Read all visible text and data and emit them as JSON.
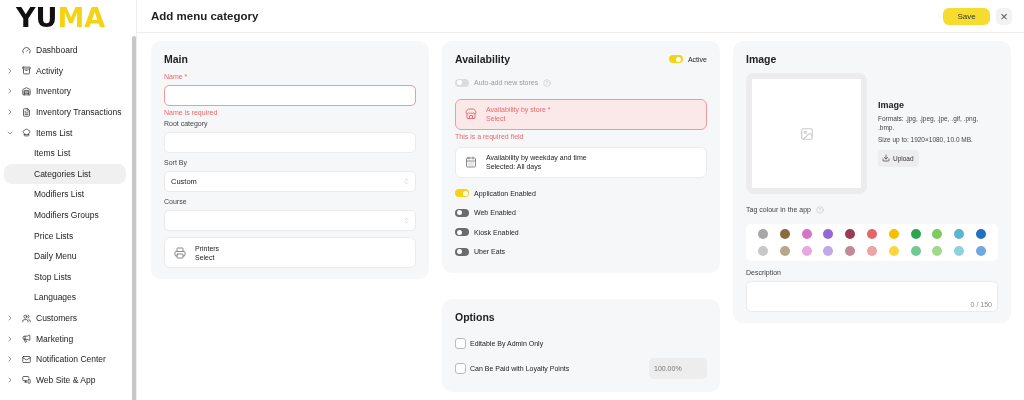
{
  "logo": {
    "dark": "YU",
    "accent": "MA"
  },
  "sidebar": {
    "items": [
      {
        "label": "Dashboard",
        "selected": false
      },
      {
        "label": "Activity",
        "selected": false,
        "expanded": false
      },
      {
        "label": "Inventory",
        "selected": false,
        "expanded": false
      },
      {
        "label": "Inventory Transactions",
        "selected": false,
        "expanded": false
      },
      {
        "label": "Items List",
        "selected": false,
        "expanded": true,
        "children": [
          {
            "label": "Items List",
            "selected": false
          },
          {
            "label": "Categories List",
            "selected": true
          },
          {
            "label": "Modifiers List",
            "selected": false
          },
          {
            "label": "Modifiers Groups",
            "selected": false
          },
          {
            "label": "Price Lists",
            "selected": false
          },
          {
            "label": "Daily Menu",
            "selected": false
          },
          {
            "label": "Stop Lists",
            "selected": false
          },
          {
            "label": "Languages",
            "selected": false
          }
        ]
      },
      {
        "label": "Customers",
        "selected": false,
        "expanded": false
      },
      {
        "label": "Marketing",
        "selected": false,
        "expanded": false
      },
      {
        "label": "Notification Center",
        "selected": false,
        "expanded": false
      },
      {
        "label": "Web Site & App",
        "selected": false,
        "expanded": false
      }
    ]
  },
  "header": {
    "title": "Add menu category",
    "save": "Save",
    "close": "×"
  },
  "main": {
    "title": "Main",
    "fields": [
      {
        "kind": "text",
        "label": "Name *",
        "error": "Name is required",
        "invalid": true
      },
      {
        "kind": "text",
        "label": "Root category",
        "invalid": false
      },
      {
        "kind": "select",
        "label": "Sort By",
        "value": "Custom",
        "invalid": false
      },
      {
        "kind": "select",
        "label": "Course",
        "invalid": false
      }
    ],
    "printers": {
      "title": "Printers",
      "value": "Select"
    }
  },
  "availability": {
    "title": "Availability",
    "active": {
      "label": "Active",
      "on": true
    },
    "auto_add": {
      "label": "Auto-add new stores",
      "on": false,
      "disabled": true
    },
    "by_store": {
      "title": "Availability by store *",
      "value": "Select",
      "invalid": true,
      "error": "This is a required field"
    },
    "by_weekday": {
      "title": "Availability by weekday and time",
      "value": "Selected: All days"
    },
    "channels": [
      {
        "label": "Application Enabled",
        "on": true
      },
      {
        "label": "Web Enabled",
        "on": false
      },
      {
        "label": "Kiosk Enabled",
        "on": false
      },
      {
        "label": "Uber Eats",
        "on": false
      }
    ]
  },
  "options": {
    "title": "Options",
    "items": [
      {
        "label": "Editable By Admin Only",
        "checked": false
      },
      {
        "label": "Can Be Paid with Loyalty Points",
        "checked": false,
        "value": "100.00%",
        "disabled": true
      }
    ]
  },
  "image": {
    "title": "Image",
    "subtitle": "Image",
    "formats": "Formats: .jpg, .jpeg, .jpe, .gif, .png, .bmp.",
    "size": "Size up to: 1920×1080, 10.0 MB.",
    "upload": "Upload",
    "tag_label": "Tag colour in the app",
    "colors": [
      {
        "color": "#a6a6a6"
      },
      {
        "color": "#8b6a3e"
      },
      {
        "color": "#d774c6"
      },
      {
        "color": "#9466d6"
      },
      {
        "color": "#9a3a55"
      },
      {
        "color": "#e26868"
      },
      {
        "color": "#f6c000"
      },
      {
        "color": "#2fa44f"
      },
      {
        "color": "#7ccd5a"
      },
      {
        "color": "#5ab6cf"
      },
      {
        "color": "#2070c4"
      },
      {
        "color": "#c8c8c8"
      },
      {
        "color": "#b9a68a"
      },
      {
        "color": "#e7a8e0"
      },
      {
        "color": "#c3a8e6"
      },
      {
        "color": "#c28a98"
      },
      {
        "color": "#eba4a4"
      },
      {
        "color": "#fcd540"
      },
      {
        "color": "#72c991"
      },
      {
        "color": "#a1d98c"
      },
      {
        "color": "#8fd0e0"
      },
      {
        "color": "#6fa8dc"
      }
    ],
    "description": {
      "label": "Description",
      "counter": "0 / 150"
    }
  }
}
